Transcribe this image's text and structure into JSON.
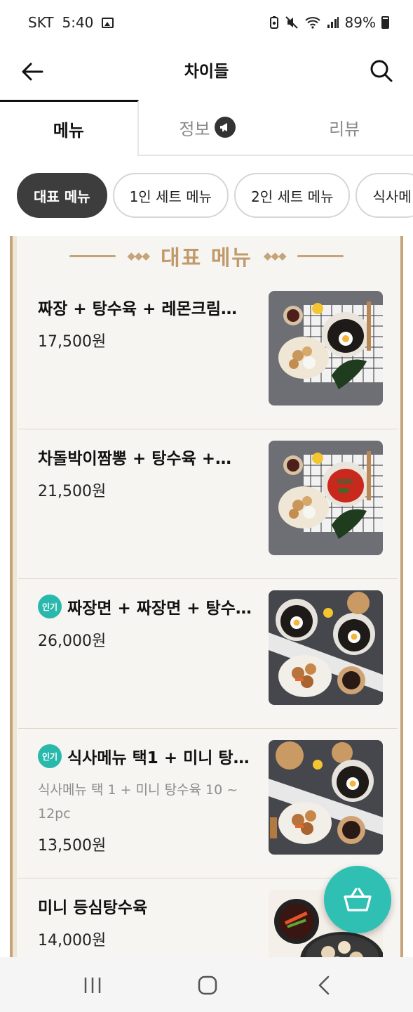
{
  "status_bar": {
    "carrier": "SKT",
    "time": "5:40",
    "battery": "89%",
    "icons": [
      "gallery-icon",
      "battery-saver-icon",
      "mute-icon",
      "wifi-icon",
      "signal-icon",
      "battery-icon"
    ]
  },
  "header": {
    "title": "차이들",
    "back_icon": "arrow-left-icon",
    "search_icon": "search-icon"
  },
  "tabs": [
    {
      "label": "메뉴",
      "active": true
    },
    {
      "label": "정보",
      "active": false,
      "badge_icon": "megaphone-icon"
    },
    {
      "label": "리뷰",
      "active": false
    }
  ],
  "chips": [
    {
      "label": "대표 메뉴",
      "active": true
    },
    {
      "label": "1인 세트 메뉴",
      "active": false
    },
    {
      "label": "2인 세트 메뉴",
      "active": false
    },
    {
      "label": "식사메",
      "active": false
    }
  ],
  "section": {
    "title": "대표 메뉴",
    "items": [
      {
        "name": "짜장 + 탕수육 + 레몬크림…",
        "price": "17,500원",
        "popular": false,
        "description": "",
        "thumb": "jjajang-tangsuyuk-photo"
      },
      {
        "name": "차돌박이짬뽕 + 탕수육 +…",
        "price": "21,500원",
        "popular": false,
        "description": "",
        "thumb": "jjamppong-tangsuyuk-photo"
      },
      {
        "name": "짜장면 + 짜장면 + 탕수…",
        "price": "26,000원",
        "popular": true,
        "badge": "인기",
        "description": "",
        "thumb": "two-jjajang-tangsuyuk-photo"
      },
      {
        "name": "식사메뉴 택1 + 미니 탕…",
        "price": "13,500원",
        "popular": true,
        "badge": "인기",
        "description": "식사메뉴 택 1 + 미니 탕수육 10 ~ 12pc",
        "thumb": "meal-mini-tangsuyuk-photo"
      },
      {
        "name": "미니 등심탕수육",
        "price": "14,000원",
        "popular": false,
        "description": "",
        "thumb": "mini-tangsuyuk-photo"
      }
    ]
  },
  "cart": {
    "icon": "basket-icon",
    "color": "#2fbfb3"
  },
  "nav": {
    "icons": [
      "recent-apps-icon",
      "home-icon",
      "back-icon"
    ]
  },
  "colors": {
    "accent_gold": "#c4a478",
    "teal": "#2fbfb3",
    "chip_active": "#3d3d3d"
  }
}
